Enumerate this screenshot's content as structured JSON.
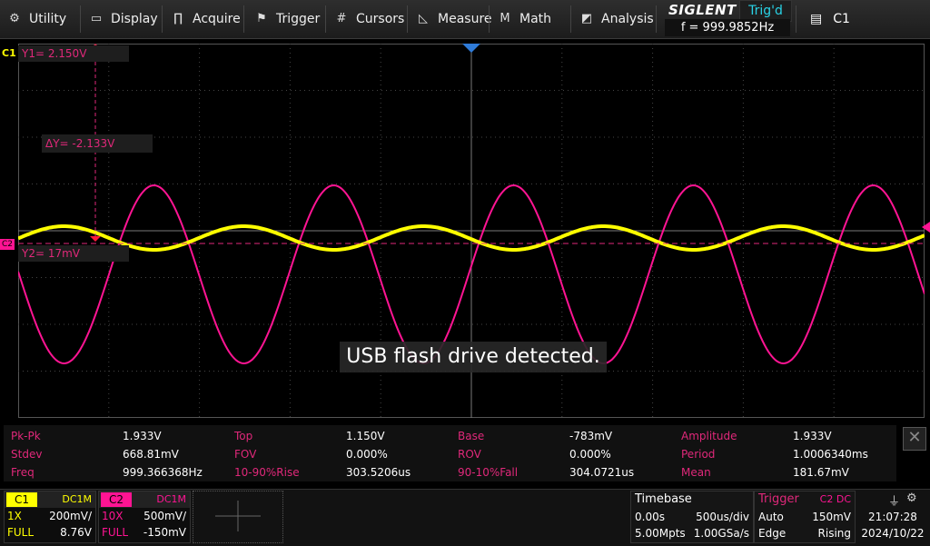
{
  "menu": {
    "utility": "Utility",
    "display": "Display",
    "acquire": "Acquire",
    "trigger": "Trigger",
    "cursors": "Cursors",
    "measure": "Measure",
    "math": "Math",
    "analysis": "Analysis"
  },
  "status": {
    "brand": "SIGLENT",
    "trig_state": "Trig'd",
    "frequency": "f = 999.9852Hz",
    "channel": "C1"
  },
  "screen": {
    "c1_marker": "C1",
    "c2_marker": "C2",
    "y1": "Y1= 2.150V",
    "dy": "ΔY= -2.133V",
    "y2": "Y2= 17mV",
    "toast": "USB flash drive detected."
  },
  "colors": {
    "c1": "#ffff00",
    "c2": "#ff1493",
    "label": "#e0287a",
    "trig_state": "#29d3e6"
  },
  "measurements": [
    [
      {
        "label": "Pk-Pk",
        "value": "1.933V"
      },
      {
        "label": "Top",
        "value": "1.150V"
      },
      {
        "label": "Base",
        "value": "-783mV"
      },
      {
        "label": "Amplitude",
        "value": "1.933V"
      }
    ],
    [
      {
        "label": "Stdev",
        "value": "668.81mV"
      },
      {
        "label": "FOV",
        "value": "0.000%"
      },
      {
        "label": "ROV",
        "value": "0.000%"
      },
      {
        "label": "Period",
        "value": "1.0006340ms"
      }
    ],
    [
      {
        "label": "Freq",
        "value": "999.366368Hz"
      },
      {
        "label": "10-90%Rise",
        "value": "303.5206us"
      },
      {
        "label": "90-10%Fall",
        "value": "304.0721us"
      },
      {
        "label": "Mean",
        "value": "181.67mV"
      }
    ]
  ],
  "channels": {
    "c1": {
      "tag": "C1",
      "coupling": "DC1M",
      "probe": "1X",
      "scale": "200mV/",
      "bw": "FULL",
      "offset": "8.76V"
    },
    "c2": {
      "tag": "C2",
      "coupling": "DC1M",
      "probe": "10X",
      "scale": "500mV/",
      "bw": "FULL",
      "offset": "-150mV"
    }
  },
  "timebase": {
    "title": "Timebase",
    "delay": "0.00s",
    "scale": "500us/div",
    "memory": "5.00Mpts",
    "rate": "1.00GSa/s"
  },
  "trigger": {
    "title": "Trigger",
    "source": "C2 DC",
    "mode": "Auto",
    "level": "150mV",
    "type": "Edge",
    "slope": "Rising"
  },
  "system": {
    "time": "21:07:28",
    "date": "2024/10/22"
  }
}
